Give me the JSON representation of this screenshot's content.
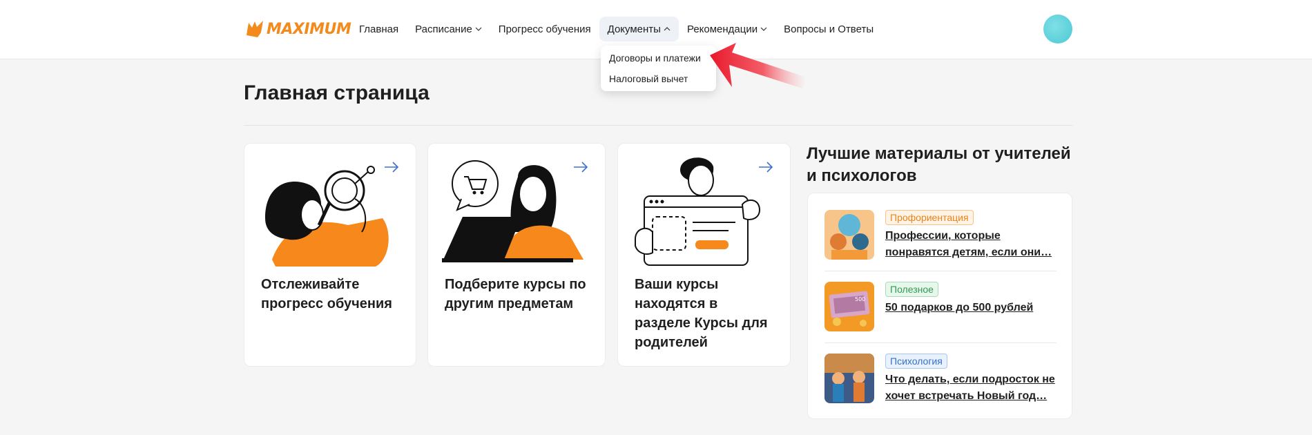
{
  "header": {
    "logo_text": "MAXIMUM",
    "nav": [
      {
        "label": "Главная",
        "has_chevron": false
      },
      {
        "label": "Расписание",
        "has_chevron": true
      },
      {
        "label": "Прогресс обучения",
        "has_chevron": false
      },
      {
        "label": "Документы",
        "has_chevron": true,
        "active": true
      },
      {
        "label": "Рекомендации",
        "has_chevron": true
      },
      {
        "label": "Вопросы и Ответы",
        "has_chevron": false
      }
    ],
    "dropdown": [
      "Договоры и платежи",
      "Налоговый вычет"
    ]
  },
  "page": {
    "title": "Главная страница"
  },
  "cards": [
    {
      "text": "Отслеживайте прогресс обучения",
      "icon": "arrow-right-icon"
    },
    {
      "text": "Подберите курсы по другим предметам",
      "icon": "arrow-right-icon"
    },
    {
      "text": "Ваши курсы находятся в разделе Курсы для родителей",
      "icon": "arrow-right-icon"
    }
  ],
  "sidebar": {
    "title": "Лучшие материалы от учителей и психологов",
    "articles": [
      {
        "tag": "Профориентация",
        "title_line1": "Профессии, которые",
        "title_line2": "понравятся детям, если они…"
      },
      {
        "tag": "Полезное",
        "title_line1": "50 подарков до 500 рублей",
        "title_line2": ""
      },
      {
        "tag": "Психология",
        "title_line1": "Что делать, если подросток не",
        "title_line2": "хочет встречать Новый год…"
      }
    ]
  },
  "colors": {
    "brand": "#f28a1c",
    "accent_blue": "#3571c7",
    "pointer_red": "#e8192c"
  }
}
